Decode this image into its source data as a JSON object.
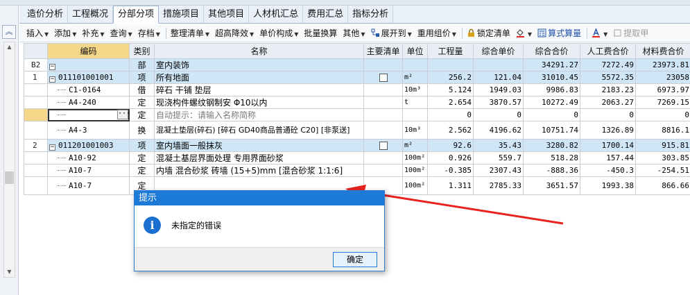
{
  "tabs": [
    {
      "label": "造价分析"
    },
    {
      "label": "工程概况"
    },
    {
      "label": "分部分项",
      "active": true
    },
    {
      "label": "措施项目"
    },
    {
      "label": "其他项目"
    },
    {
      "label": "人材机汇总"
    },
    {
      "label": "费用汇总"
    },
    {
      "label": "指标分析"
    }
  ],
  "toolbar": {
    "insert": "插入",
    "add": "添加",
    "supplement": "补充",
    "query": "查询",
    "archive": "存档",
    "organize": "整理清单",
    "super_reduce": "超高降效",
    "unit_price": "单价构成",
    "batch_convert": "批量换算",
    "other": "其他",
    "expand_to": "展开到",
    "reuse_price": "重用组价",
    "lock_list": "锁定清单",
    "formula_calc": "算式算量",
    "extract": "提取甲"
  },
  "grid": {
    "headers": {
      "code": "编码",
      "type": "类别",
      "name": "名称",
      "main": "主要清单",
      "unit": "单位",
      "qty": "工程量",
      "unit_price": "综合单价",
      "total": "综合合价",
      "labor": "人工费合价",
      "material": "材料费合价"
    },
    "rows": [
      {
        "rn": "B2",
        "code": "",
        "type": "部",
        "name": "室内装饰",
        "unit": "",
        "qty": "",
        "price": "",
        "total": "34291.27",
        "labor": "7272.49",
        "material": "23973.81"
      },
      {
        "rn": "1",
        "code": "011101001001",
        "type": "项",
        "name": "所有地面",
        "unit": "m²",
        "qty": "256.2",
        "price": "121.04",
        "total": "31010.45",
        "labor": "5572.35",
        "material": "23058"
      },
      {
        "rn": "",
        "code": "C1-0164",
        "type": "借",
        "name": "碎石 干铺 垫层",
        "unit": "10m³",
        "qty": "5.124",
        "price": "1949.03",
        "total": "9986.83",
        "labor": "2183.23",
        "material": "6973.97"
      },
      {
        "rn": "",
        "code": "A4-240",
        "type": "定",
        "name": "现浇构件螺纹钢制安 Φ10以内",
        "unit": "t",
        "qty": "2.654",
        "price": "3870.57",
        "total": "10272.49",
        "labor": "2063.27",
        "material": "7269.15"
      },
      {
        "rn": "",
        "code": "",
        "type": "定",
        "name": "自动提示：请输入名称简称",
        "unit": "",
        "qty": "0",
        "price": "0",
        "total": "0",
        "labor": "0",
        "material": "0"
      },
      {
        "rn": "",
        "code": "A4-3",
        "type": "换",
        "name": "混凝土垫层(碎石) [碎石 GD40商品普通砼 C20] [非泵送]",
        "unit": "10m³",
        "qty": "2.562",
        "price": "4196.62",
        "total": "10751.74",
        "labor": "1326.89",
        "material": "8816.1"
      },
      {
        "rn": "2",
        "code": "011201001003",
        "type": "项",
        "name": "室内墙面一般抹灰",
        "unit": "m²",
        "qty": "92.6",
        "price": "35.43",
        "total": "3280.82",
        "labor": "1700.14",
        "material": "915.81"
      },
      {
        "rn": "",
        "code": "A10-92",
        "type": "定",
        "name": "混凝土基层界面处理 专用界面砂浆",
        "unit": "100m²",
        "qty": "0.926",
        "price": "559.7",
        "total": "518.28",
        "labor": "157.44",
        "material": "303.85"
      },
      {
        "rn": "",
        "code": "A10-7",
        "type": "定",
        "name": "内墙 混合砂浆 砖墙 (15+5)mm [混合砂浆 1:1:6]",
        "unit": "100m²",
        "qty": "-0.385",
        "price": "2307.43",
        "total": "-888.36",
        "labor": "-450.3",
        "material": "-254.51"
      },
      {
        "rn": "",
        "code": "A10-7",
        "type": "定",
        "name": "",
        "unit": "100m²",
        "qty": "1.311",
        "price": "2785.33",
        "total": "3651.57",
        "labor": "1993.38",
        "material": "866.66"
      }
    ]
  },
  "dialog": {
    "title": "提示",
    "message": "未指定的错误",
    "ok": "确定"
  },
  "colors": {
    "accent": "#1e7ad7",
    "row_highlight": "#cfe6f6",
    "header_highlight": "#f5d78a",
    "annotation": "#e8231f"
  }
}
